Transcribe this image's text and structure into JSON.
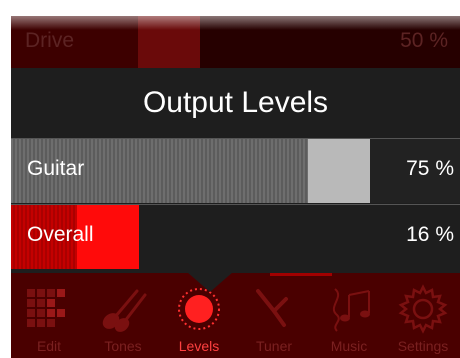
{
  "drive": {
    "label": "Drive",
    "value": "50 %",
    "fraction": 0.5
  },
  "panel": {
    "title": "Output Levels",
    "levels": [
      {
        "label": "Guitar",
        "value": "75 %",
        "fraction": 0.75
      },
      {
        "label": "Overall",
        "value": "16 %",
        "fraction": 0.16
      }
    ]
  },
  "tabs": [
    {
      "label": "Edit",
      "icon": "grid-icon"
    },
    {
      "label": "Tones",
      "icon": "guitars-icon"
    },
    {
      "label": "Levels",
      "icon": "record-dot-icon",
      "active": true
    },
    {
      "label": "Tuner",
      "icon": "tuning-fork-icon"
    },
    {
      "label": "Music",
      "icon": "music-notes-icon"
    },
    {
      "label": "Settings",
      "icon": "gear-icon"
    }
  ],
  "colors": {
    "accent_red": "#ff0a0a",
    "panel_bg": "#1e1e1e",
    "tabbar_bg": "#4a0000",
    "active_tab_text": "#ff4040",
    "inactive_tab_text": "#7a2020"
  }
}
